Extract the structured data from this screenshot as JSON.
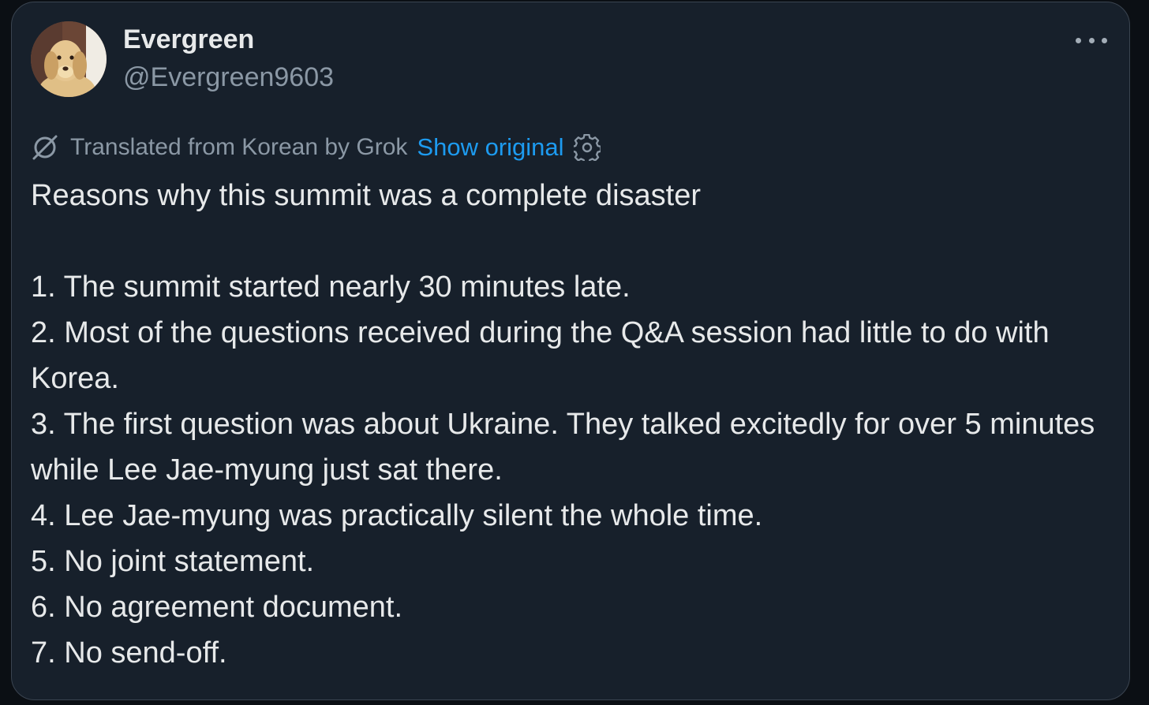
{
  "author": {
    "name": "Evergreen",
    "handle": "@Evergreen9603"
  },
  "translation": {
    "label": "Translated from Korean by Grok",
    "show_original": "Show original"
  },
  "icons": {
    "translate": "grok-translate-icon",
    "settings": "gear-icon",
    "more": "more-horizontal-icon"
  },
  "colors": {
    "background": "#17202b",
    "text": "#e7e9ea",
    "secondary_text": "#8b98a5",
    "link": "#1d9bf0"
  },
  "tweet": {
    "headline": "Reasons why this summit was a complete disaster",
    "items": [
      "1. The summit started nearly 30 minutes late.",
      "2. Most of the questions received during the Q&A session had little to do with Korea.",
      "3. The first question was about Ukraine. They talked excitedly for over 5 minutes while Lee Jae-myung just sat there.",
      "4. Lee Jae-myung was practically silent the whole time.",
      "5. No joint statement.",
      "6. No agreement document.",
      "7. No send-off."
    ]
  }
}
